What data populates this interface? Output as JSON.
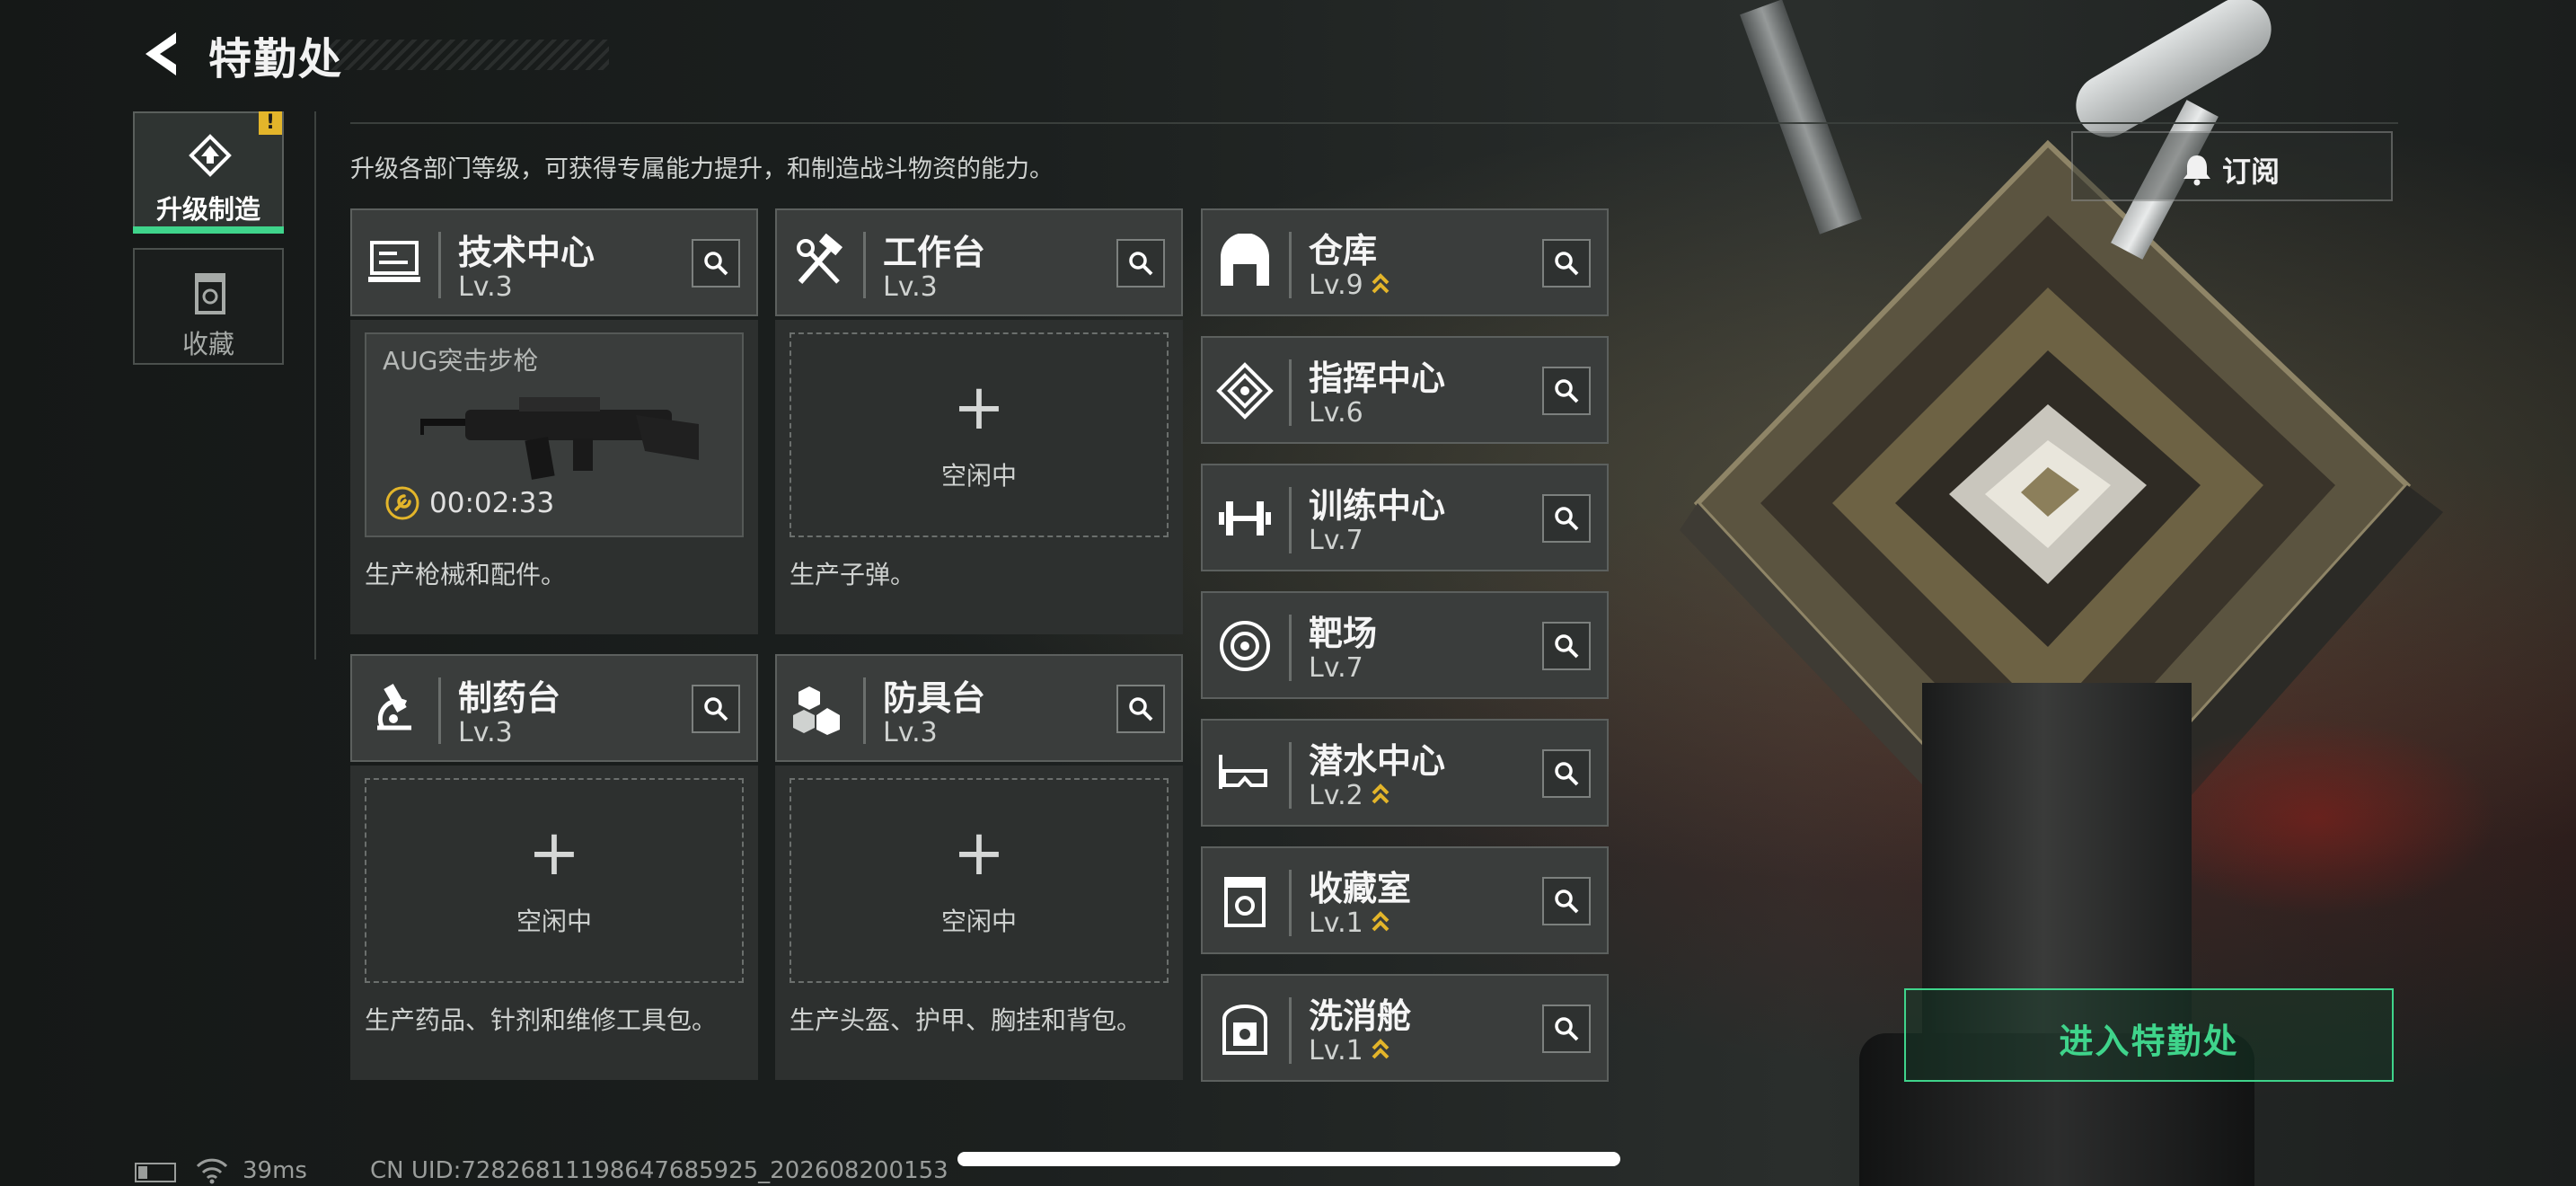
{
  "header": {
    "title": "特勤处"
  },
  "sidebar": {
    "tabs": [
      {
        "label": "升级制造",
        "icon": "upgrade-icon",
        "active": true,
        "alert": "!"
      },
      {
        "label": "收藏",
        "icon": "collection-icon",
        "active": false
      }
    ]
  },
  "intro": "升级各部门等级，可获得专属能力提升，和制造战斗物资的能力。",
  "subscribe": {
    "label": "订阅",
    "icon": "bell-icon"
  },
  "production": [
    {
      "name": "技术中心",
      "level": "Lv.3",
      "icon": "tech-center-icon",
      "slot": {
        "state": "busy",
        "item": "AUG突击步枪",
        "timer": "00:02:33"
      },
      "desc": "生产枪械和配件。"
    },
    {
      "name": "工作台",
      "level": "Lv.3",
      "icon": "hammer-wrench-icon",
      "slot": {
        "state": "idle",
        "label": "空闲中"
      },
      "desc": "生产子弹。"
    },
    {
      "name": "制药台",
      "level": "Lv.3",
      "icon": "microscope-icon",
      "slot": {
        "state": "idle",
        "label": "空闲中"
      },
      "desc": "生产药品、针剂和维修工具包。"
    },
    {
      "name": "防具台",
      "level": "Lv.3",
      "icon": "armor-blocks-icon",
      "slot": {
        "state": "idle",
        "label": "空闲中"
      },
      "desc": "生产头盔、护甲、胸挂和背包。"
    }
  ],
  "facilities": [
    {
      "name": "仓库",
      "level": "Lv.9",
      "upgradable": true,
      "icon": "warehouse-icon"
    },
    {
      "name": "指挥中心",
      "level": "Lv.6",
      "upgradable": false,
      "icon": "command-center-icon"
    },
    {
      "name": "训练中心",
      "level": "Lv.7",
      "upgradable": false,
      "icon": "dumbbell-icon"
    },
    {
      "name": "靶场",
      "level": "Lv.7",
      "upgradable": false,
      "icon": "target-icon"
    },
    {
      "name": "潜水中心",
      "level": "Lv.2",
      "upgradable": true,
      "icon": "diving-mask-icon"
    },
    {
      "name": "收藏室",
      "level": "Lv.1",
      "upgradable": true,
      "icon": "collection-room-icon"
    },
    {
      "name": "洗消舱",
      "level": "Lv.1",
      "upgradable": true,
      "icon": "decon-pod-icon"
    }
  ],
  "enter_button": "进入特勤处",
  "status_bar": {
    "ping": "39ms",
    "uid": "CN UID:7282681119864768592​5_202608200153"
  },
  "colors": {
    "accent": "#3fd48b",
    "upgrade_arrow": "#e3b52a",
    "alert": "#e3b52a"
  }
}
